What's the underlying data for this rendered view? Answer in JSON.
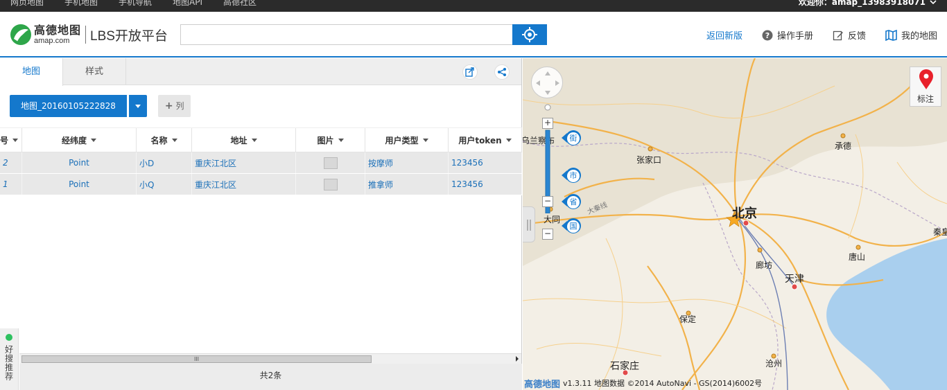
{
  "topbar": {
    "links": [
      "网页地图",
      "手机地图",
      "手机导航",
      "地图API",
      "高德社区"
    ],
    "welcome": "欢迎你：amap_13983918071"
  },
  "header": {
    "logo_cn": "高德地图",
    "logo_en": "amap.com",
    "platform": "LBS开放平台",
    "search_value": "",
    "nav": {
      "back": "返回新版",
      "manual": "操作手册",
      "feedback": "反馈",
      "mymap": "我的地图"
    }
  },
  "panel": {
    "tabs": [
      "地图",
      "样式"
    ],
    "map_name": "地图_20160105222828",
    "add_column": "列",
    "columns": [
      "号",
      "经纬度",
      "名称",
      "地址",
      "图片",
      "用户类型",
      "用户token"
    ],
    "rows": [
      {
        "id": "2",
        "geo": "Point",
        "name": "小D",
        "address": "重庆江北区",
        "type": "按摩师",
        "token": "123456"
      },
      {
        "id": "1",
        "geo": "Point",
        "name": "小Q",
        "address": "重庆江北区",
        "type": "推拿师",
        "token": "123456"
      }
    ],
    "scroll_grip": "III",
    "count_text": "共2条",
    "side_recommend": "好搜推荐"
  },
  "map": {
    "zoom_levels": [
      "街",
      "市",
      "省",
      "国"
    ],
    "zoom_in": "+",
    "zoom_out": "−",
    "zoom_min": "−",
    "marker_label": "标注",
    "cities": {
      "beijing": "北京",
      "tianjin": "天津",
      "zhangjiakou": "张家口",
      "chengde": "承德",
      "datong": "大同",
      "wulanchabu": "乌兰察布",
      "langfang": "廊坊",
      "tangshan": "唐山",
      "baoding": "保定",
      "shijiazhuang": "石家庄",
      "cangzhou": "沧州",
      "qinhuangdao": "秦皇",
      "highway": "大秦线"
    },
    "attribution_brand": "高德地图",
    "attribution_text": "v1.3.11 地图数据 ©2014 AutoNavi - GS(2014)6002号"
  },
  "colors": {
    "accent": "#1478cc",
    "row_bg": "#e8e8e8",
    "link": "#1a6fb8"
  }
}
